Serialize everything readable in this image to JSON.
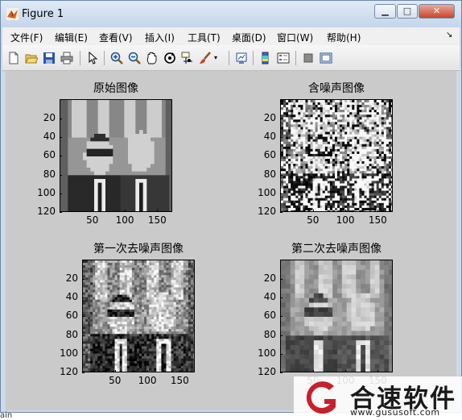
{
  "window": {
    "title": "Figure 1",
    "controls": {
      "minimize": "▁",
      "maximize": "□",
      "close": "✕"
    }
  },
  "menu": [
    "文件(F)",
    "编辑(E)",
    "查看(V)",
    "插入(I)",
    "工具(T)",
    "桌面(D)",
    "窗口(W)",
    "帮助(H)"
  ],
  "menu_arrow": "↘",
  "toolbar": [
    "new-figure-icon",
    "open-file-icon",
    "save-icon",
    "print-icon",
    "pointer-icon",
    "zoom-in-icon",
    "zoom-out-icon",
    "pan-icon",
    "rotate-3d-icon",
    "data-cursor-icon",
    "brush-icon",
    "link-plot-icon",
    "colorbar-icon",
    "legend-icon",
    "hide-plot-tools-icon",
    "show-plot-tools-icon"
  ],
  "plots": [
    {
      "title": "原始图像",
      "variant": "original"
    },
    {
      "title": "含噪声图像",
      "variant": "noisy"
    },
    {
      "title": "第一次去噪声图像",
      "variant": "denoise1"
    },
    {
      "title": "第二次去噪声图像",
      "variant": "denoise2"
    }
  ],
  "axes": {
    "y_ticks": [
      "20",
      "40",
      "60",
      "80",
      "100",
      "120"
    ],
    "x_ticks": [
      "50",
      "100",
      "150"
    ]
  },
  "watermark": {
    "name": "合速软件",
    "url": "www.gususoft.com",
    "accent": "#c8202a"
  },
  "fragment": "ain"
}
